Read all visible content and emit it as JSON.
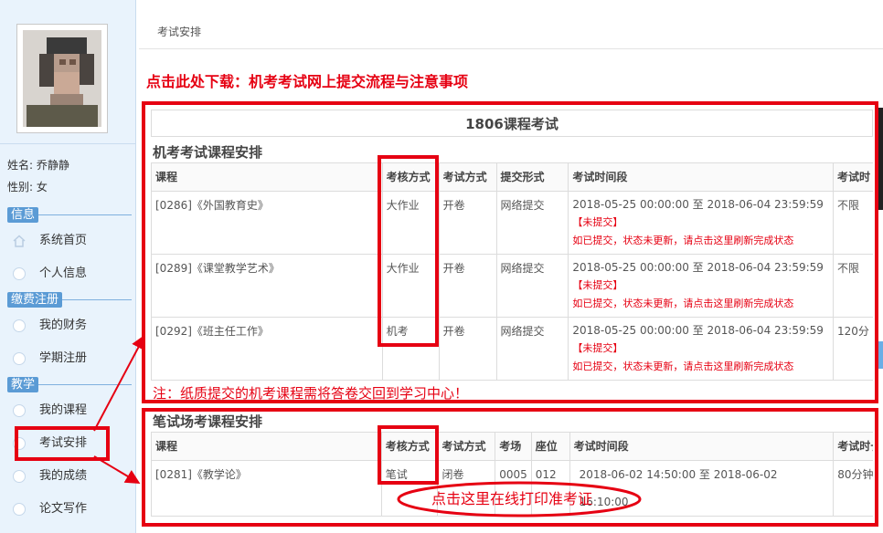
{
  "sidebar": {
    "name_label": "姓名:",
    "name_value": "乔静静",
    "gender_label": "性别:",
    "gender_value": "女",
    "sections": [
      {
        "label": "信息"
      },
      {
        "label": "缴费注册"
      },
      {
        "label": "教学"
      }
    ],
    "items": [
      {
        "label": "系统首页",
        "icon": "home-icon"
      },
      {
        "label": "个人信息",
        "icon": "circle-icon"
      },
      {
        "label": "我的财务",
        "icon": "circle-icon"
      },
      {
        "label": "学期注册",
        "icon": "circle-icon"
      },
      {
        "label": "我的课程",
        "icon": "circle-icon"
      },
      {
        "label": "考试安排",
        "icon": "circle-icon"
      },
      {
        "label": "我的成绩",
        "icon": "circle-icon"
      },
      {
        "label": "论文写作",
        "icon": "circle-icon"
      }
    ]
  },
  "breadcrumb": "考试安排",
  "download_link": "点击此处下载：机考考试网上提交流程与注意事项",
  "exam_title": "1806课程考试",
  "online": {
    "section_title": "机考考试课程安排",
    "headers": [
      "课程",
      "考核方式",
      "考试方式",
      "提交形式",
      "考试时间段",
      "考试时"
    ],
    "rows": [
      {
        "course": "[0286]《外国教育史》",
        "assess": "大作业",
        "mode": "开卷",
        "submit": "网络提交",
        "time": "2018-05-25 00:00:00 至 2018-06-04 23:59:59",
        "status": "【未提交】",
        "refresh": "如已提交，状态未更新，请点击这里刷新完成状态",
        "duration": "不限"
      },
      {
        "course": "[0289]《课堂教学艺术》",
        "assess": "大作业",
        "mode": "开卷",
        "submit": "网络提交",
        "time": "2018-05-25 00:00:00 至 2018-06-04 23:59:59",
        "status": "【未提交】",
        "refresh": "如已提交，状态未更新，请点击这里刷新完成状态",
        "duration": "不限"
      },
      {
        "course": "[0292]《班主任工作》",
        "assess": "机考",
        "mode": "开卷",
        "submit": "网络提交",
        "time": "2018-05-25 00:00:00 至 2018-06-04 23:59:59",
        "status": "【未提交】",
        "refresh": "如已提交，状态未更新，请点击这里刷新完成状态",
        "duration": "120分"
      }
    ],
    "note": "注：纸质提交的机考课程需将答卷交回到学习中心！"
  },
  "written": {
    "section_title": "笔试场考课程安排",
    "headers": [
      "课程",
      "考核方式",
      "考试方式",
      "考场",
      "座位",
      "考试时间段",
      "考试时长"
    ],
    "rows": [
      {
        "course": "[0281]《教学论》",
        "assess": "笔试",
        "mode": "闭卷",
        "room": "0005",
        "seat": "012",
        "time": "2018-06-02 14:50:00 至 2018-06-02 16:10:00",
        "duration": "80分钟"
      }
    ],
    "print_link": "点击这里在线打印准考证"
  },
  "colors": {
    "accent_red": "#e60012",
    "sidebar_bg": "#e9f3fc",
    "section_blue": "#5b9bd5"
  }
}
